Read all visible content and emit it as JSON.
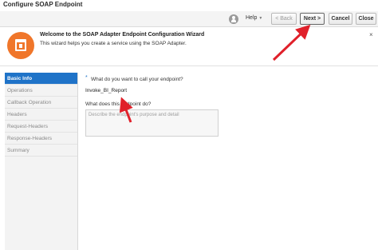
{
  "window": {
    "title": "Configure SOAP Endpoint"
  },
  "toolbar": {
    "help_label": "Help",
    "back_label": "< Back",
    "next_label": "Next >",
    "cancel_label": "Cancel",
    "close_label": "Close"
  },
  "banner": {
    "title": "Welcome to the SOAP Adapter Endpoint Configuration Wizard",
    "subtitle": "This wizard helps you create a service using the SOAP Adapter.",
    "close_glyph": "×"
  },
  "sidebar": {
    "items": [
      {
        "label": "Basic Info",
        "active": true
      },
      {
        "label": "Operations",
        "active": false
      },
      {
        "label": "Callback Operation",
        "active": false
      },
      {
        "label": "Headers",
        "active": false
      },
      {
        "label": "Request-Headers",
        "active": false
      },
      {
        "label": "Response-Headers",
        "active": false
      },
      {
        "label": "Summary",
        "active": false
      }
    ]
  },
  "form": {
    "required_marker": "*",
    "name_question": "What do you want to call your endpoint?",
    "name_value": "Invoke_BI_Report",
    "desc_question": "What does this endpoint do?",
    "desc_placeholder": "Describe the endpoint's purpose and detail"
  },
  "colors": {
    "accent": "#1f73c8",
    "brand": "#f0762a",
    "annotation": "#e0202a"
  }
}
